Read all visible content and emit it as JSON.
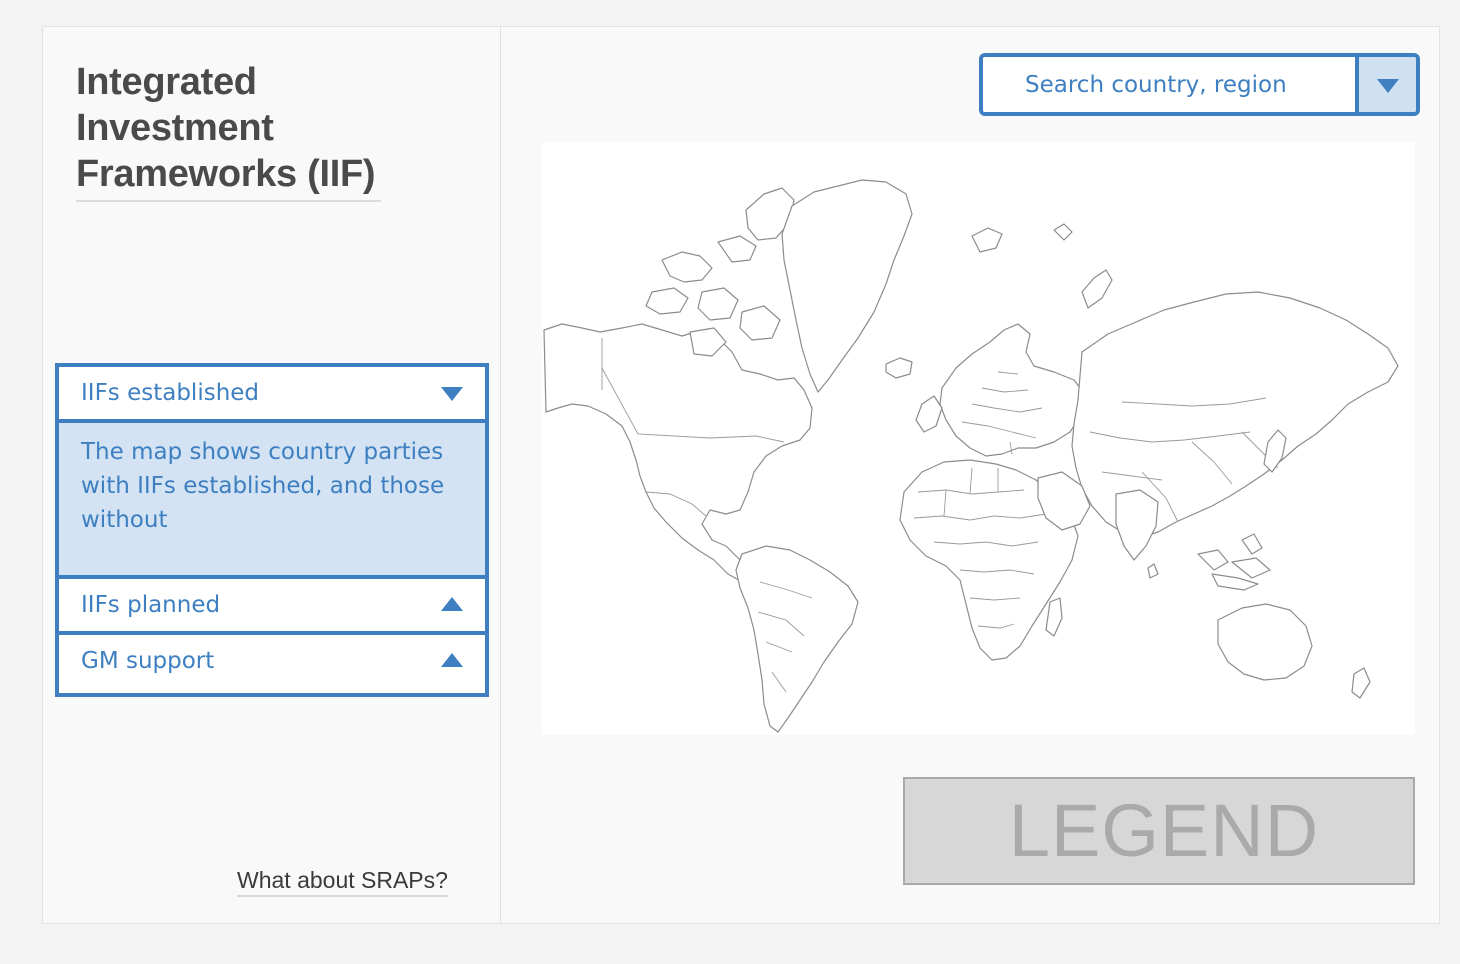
{
  "sidebar": {
    "title": "Integrated Investment Frameworks (IIF)",
    "accordion": [
      {
        "label": "IIFs established",
        "expanded": true,
        "body": "The map shows country parties with IIFs established, and those without"
      },
      {
        "label": "IIFs planned",
        "expanded": false
      },
      {
        "label": "GM support",
        "expanded": false
      }
    ],
    "srap_link": "What about SRAPs?"
  },
  "search": {
    "placeholder": "Search country, region",
    "dropdown_icon": "triangle-down-icon"
  },
  "map": {
    "kind": "world-outline-map",
    "fill": "#ffffff",
    "stroke": "#8c8c8c"
  },
  "legend": {
    "label": "LEGEND"
  },
  "colors": {
    "accent": "#3d7fc1",
    "accordion_body_bg": "#d3e3f3",
    "legend_bg": "#d7d7d7"
  }
}
